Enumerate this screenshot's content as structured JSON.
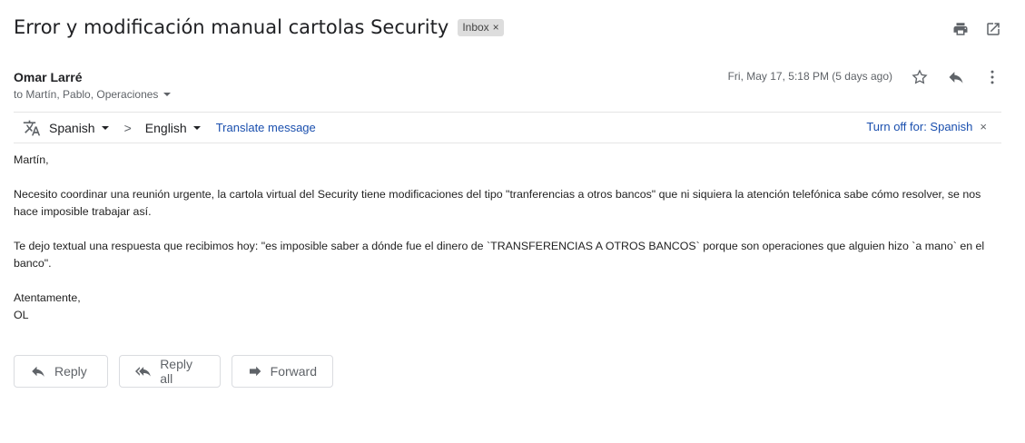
{
  "subject": "Error y modificación manual cartolas Security",
  "label_chip": {
    "text": "Inbox",
    "remove": "×"
  },
  "sender": {
    "name": "Omar Larré",
    "recipients": "to Martín, Pablo, Operaciones"
  },
  "date": "Fri, May 17, 5:18 PM (5 days ago)",
  "translate": {
    "from_lang": "Spanish",
    "to_lang": "English",
    "arrow": ">",
    "translate_link": "Translate message",
    "turn_off": "Turn off for: Spanish",
    "close": "×"
  },
  "body": {
    "greeting": "Martín,",
    "para1": "Necesito coordinar una reunión urgente, la cartola virtual del Security tiene modificaciones del tipo \"tranferencias a otros bancos\" que ni siquiera la atención telefónica sabe cómo resolver, se nos hace imposible trabajar así.",
    "para2": "Te dejo textual una respuesta que recibimos hoy: \"es imposible saber a dónde fue el dinero de `TRANSFERENCIAS A OTROS BANCOS` porque son operaciones que alguien hizo `a mano` en el banco\".",
    "sign1": "Atentamente,",
    "sign2": "OL"
  },
  "actions": {
    "reply": "Reply",
    "reply_all": "Reply all",
    "forward": "Forward"
  },
  "icons": {
    "print": "print-icon",
    "open_new": "open-in-new-icon",
    "star": "star-icon",
    "reply": "reply-icon",
    "more": "more-vert-icon",
    "translate": "translate-icon"
  },
  "colors": {
    "link": "#1a4fae",
    "chip_bg": "#dddddd",
    "text": "#202124",
    "muted": "#5f6368"
  }
}
